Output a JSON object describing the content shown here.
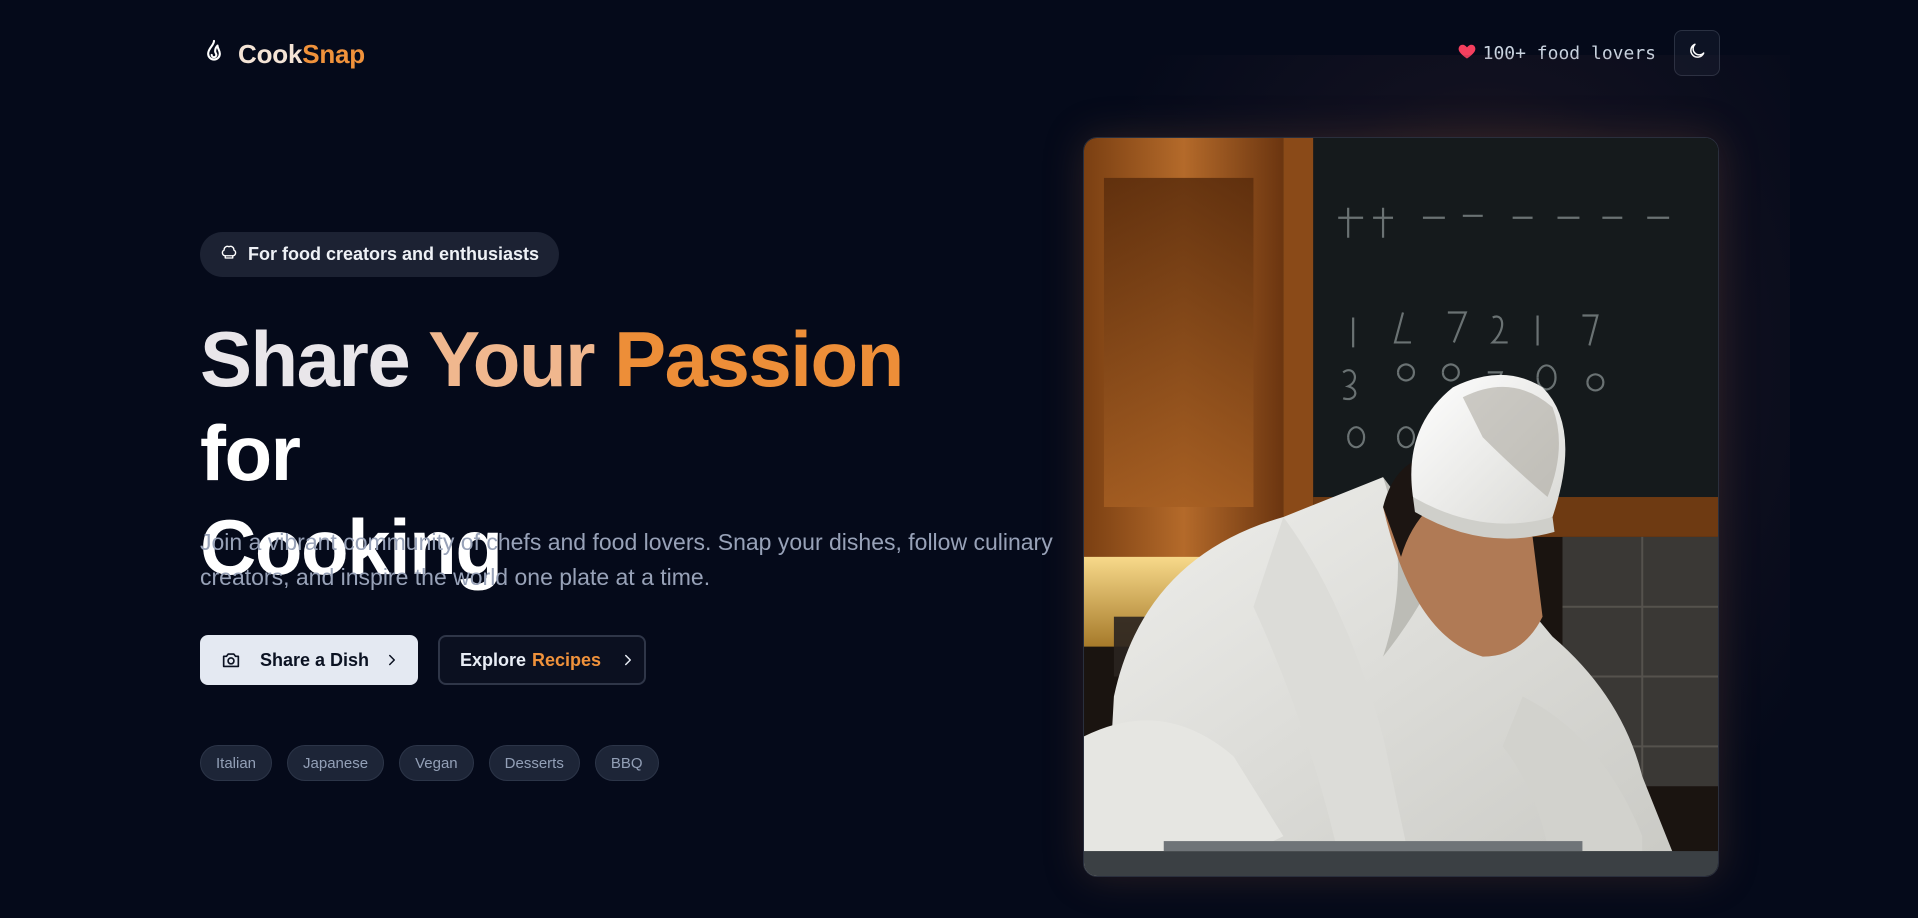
{
  "brand": {
    "part1": "Cook",
    "part2": "Snap",
    "icon": "flame-icon"
  },
  "header": {
    "lovers_text": "100+ food lovers",
    "lovers_icon": "heart-icon",
    "theme_toggle_icon": "moon-icon"
  },
  "hero": {
    "badge": {
      "icon": "chef-hat-icon",
      "label": "For food creators and enthusiasts"
    },
    "headline": {
      "word1": "Share",
      "word2": "Your",
      "word3": "Passion",
      "word4": "for",
      "word5": "Cooking"
    },
    "subtitle": "Join a vibrant community of chefs and food lovers. Snap your dishes, follow culinary creators, and inspire the world one plate at a time.",
    "primary_button": {
      "label": "Share a Dish",
      "icon": "camera-icon"
    },
    "secondary_button": {
      "label_part1": "Explore",
      "label_part2": "Recipes"
    },
    "tags": [
      "Italian",
      "Japanese",
      "Vegan",
      "Desserts",
      "BBQ"
    ],
    "image": {
      "subject": "chef in white hat cooking in Japanese kitchen"
    }
  },
  "colors": {
    "background": "#050a1a",
    "accent": "#f0923b",
    "primary_button_bg": "#e4e9f2",
    "heart": "#f43f5e"
  }
}
